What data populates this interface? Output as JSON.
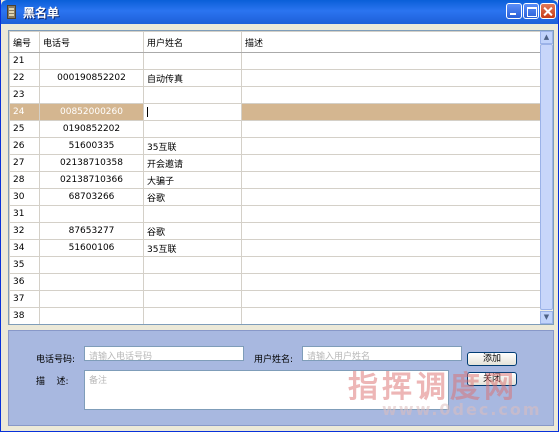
{
  "window": {
    "title": "黑名单"
  },
  "table": {
    "headers": [
      "编号",
      "电话号",
      "用户姓名",
      "描述"
    ],
    "rows": [
      {
        "id": "21",
        "phone": "",
        "name": "",
        "desc": ""
      },
      {
        "id": "22",
        "phone": "000190852202",
        "name": "自动传真",
        "desc": ""
      },
      {
        "id": "23",
        "phone": "",
        "name": "",
        "desc": ""
      },
      {
        "id": "24",
        "phone": "00852000260",
        "name": "",
        "desc": "",
        "selected": true
      },
      {
        "id": "25",
        "phone": "0190852202",
        "name": "",
        "desc": ""
      },
      {
        "id": "26",
        "phone": "51600335",
        "name": "35互联",
        "desc": ""
      },
      {
        "id": "27",
        "phone": "02138710358",
        "name": "开会邀请",
        "desc": ""
      },
      {
        "id": "28",
        "phone": "02138710366",
        "name": "大骗子",
        "desc": ""
      },
      {
        "id": "30",
        "phone": "68703266",
        "name": "谷歌",
        "desc": ""
      },
      {
        "id": "31",
        "phone": "",
        "name": "",
        "desc": ""
      },
      {
        "id": "32",
        "phone": "87653277",
        "name": "谷歌",
        "desc": ""
      },
      {
        "id": "34",
        "phone": "51600106",
        "name": "35互联",
        "desc": ""
      },
      {
        "id": "35",
        "phone": "",
        "name": "",
        "desc": ""
      },
      {
        "id": "36",
        "phone": "",
        "name": "",
        "desc": ""
      },
      {
        "id": "37",
        "phone": "",
        "name": "",
        "desc": ""
      },
      {
        "id": "38",
        "phone": "",
        "name": "",
        "desc": ""
      }
    ]
  },
  "form": {
    "phone_label": "电话号码:",
    "phone_placeholder": "请输入电话号码",
    "user_label": "用户姓名:",
    "user_placeholder": "请输入用户姓名",
    "desc_label": "描    述:",
    "desc_placeholder": "备注",
    "add_button": "添加",
    "second_button": "关闭"
  },
  "watermark": {
    "text": "指挥调度网",
    "url": "www.0dec.com"
  },
  "colors": {
    "titlebar": "#2b74f0",
    "selected_row": "#d4b690",
    "panel": "#a8b8e0"
  }
}
